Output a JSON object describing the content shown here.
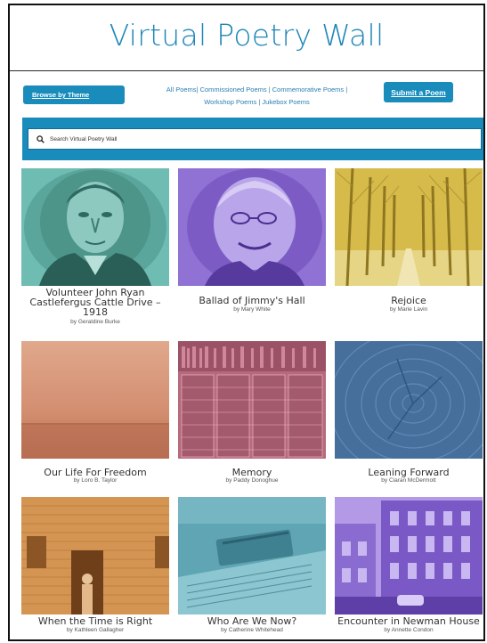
{
  "header": {
    "title": "Virtual Poetry Wall",
    "browse_theme": "Browse by Theme",
    "submit": "Submit a Poem",
    "nav_line1": "All Poems| Commissioned Poems | Commemorative Poems |",
    "nav_line2": "Workshop Poems | Jukebox Poems"
  },
  "search": {
    "placeholder": "Search Virtual Poetry Wall"
  },
  "colors": {
    "accent": "#1a8cbc",
    "teal": "#63b3aa",
    "purple": "#8d6bd0",
    "mustard": "#c7a83a",
    "terracotta": "#d0866a",
    "rose": "#b86a7c",
    "slate": "#4a7ca6",
    "orange": "#d49553",
    "sea": "#5fa5b3",
    "lavender": "#9a78d4"
  },
  "poems": [
    {
      "title": "Volunteer John Ryan Castlefergus Cattle Drive – 1918",
      "author": "by Geraldine Burke",
      "image": "portrait-man-icon"
    },
    {
      "title": "Ballad of Jimmy's Hall",
      "author": "by Mary White",
      "image": "portrait-old-man-icon"
    },
    {
      "title": "Rejoice",
      "author": "by Marie Lavin",
      "image": "tree-avenue-icon"
    },
    {
      "title": "Our Life For Freedom",
      "author": "by Loro B. Taylor",
      "image": "sea-horizon-icon"
    },
    {
      "title": "Memory",
      "author": "by Paddy Donoghue",
      "image": "archive-shelves-icon"
    },
    {
      "title": "Leaning Forward",
      "author": "by Ciaran McDermott",
      "image": "tree-rings-icon"
    },
    {
      "title": "When the Time is Right",
      "author": "by Kathleen Gallagher",
      "image": "brick-house-icon"
    },
    {
      "title": "Who Are We Now?",
      "author": "by Catherine Whitehead",
      "image": "papers-pen-icon"
    },
    {
      "title": "Encounter in Newman House",
      "author": "by Annette Condon",
      "image": "georgian-building-icon"
    }
  ]
}
